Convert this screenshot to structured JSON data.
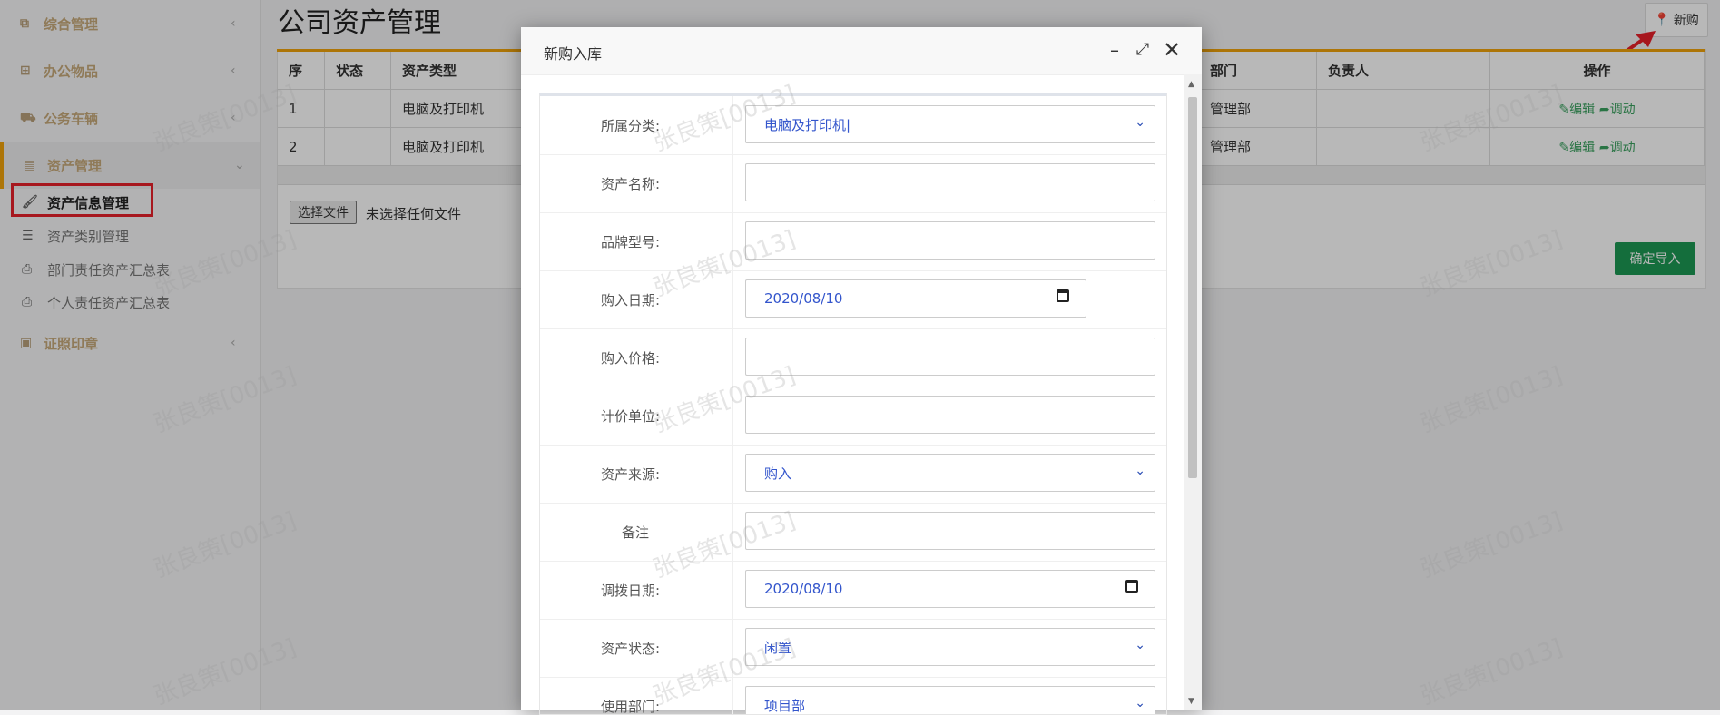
{
  "sidebar": {
    "items": [
      {
        "label": "综合管理",
        "icon": "copy-icon",
        "chevron": "‹"
      },
      {
        "label": "办公物品",
        "icon": "windows-icon",
        "chevron": "‹"
      },
      {
        "label": "公务车辆",
        "icon": "car-icon",
        "chevron": "‹"
      },
      {
        "label": "资产管理",
        "icon": "save-icon",
        "chevron": "⌄"
      },
      {
        "label": "证照印章",
        "icon": "facebook-square-icon",
        "chevron": "‹"
      }
    ],
    "subitems": [
      {
        "label": "资产信息管理",
        "icon": "brush-icon"
      },
      {
        "label": "资产类别管理",
        "icon": "list-icon"
      },
      {
        "label": "部门责任资产汇总表",
        "icon": "print-icon"
      },
      {
        "label": "个人责任资产汇总表",
        "icon": "print-icon"
      }
    ]
  },
  "page": {
    "title": "公司资产管理",
    "new_button": "新购",
    "import_button": "确定导入",
    "file_button": "选择文件",
    "file_status": "未选择任何文件"
  },
  "table": {
    "headers": [
      "序",
      "状态",
      "资产类型",
      "部门",
      "负责人",
      "操作"
    ],
    "rows": [
      {
        "no": "1",
        "status": "",
        "type": "电脑及打印机",
        "dept": "管理部",
        "owner": ""
      },
      {
        "no": "2",
        "status": "",
        "type": "电脑及打印机",
        "dept": "管理部",
        "owner": ""
      }
    ],
    "actions": {
      "edit": "编辑",
      "transfer": "调动"
    }
  },
  "modal": {
    "title": "新购入库",
    "fields": [
      {
        "label": "所属分类:",
        "value": "电脑及打印机|",
        "kind": "select"
      },
      {
        "label": "资产名称:",
        "value": "",
        "kind": "text"
      },
      {
        "label": "品牌型号:",
        "value": "",
        "kind": "text"
      },
      {
        "label": "购入日期:",
        "value": "2020/08/10",
        "kind": "date-short"
      },
      {
        "label": "购入价格:",
        "value": "",
        "kind": "text"
      },
      {
        "label": "计价单位:",
        "value": "",
        "kind": "text"
      },
      {
        "label": "资产来源:",
        "value": "购入",
        "kind": "select"
      },
      {
        "label": "备注",
        "value": "",
        "kind": "text"
      },
      {
        "label": "调拨日期:",
        "value": "2020/08/10",
        "kind": "date"
      },
      {
        "label": "资产状态:",
        "value": "闲置",
        "kind": "select"
      },
      {
        "label": "使用部门:",
        "value": "项目部",
        "kind": "select"
      }
    ]
  },
  "watermark": "张良策[0013]",
  "colors": {
    "accent": "#f0a30a",
    "highlight": "#e8202a",
    "primary_green": "#1c9954",
    "link_blue": "#3355cc"
  }
}
